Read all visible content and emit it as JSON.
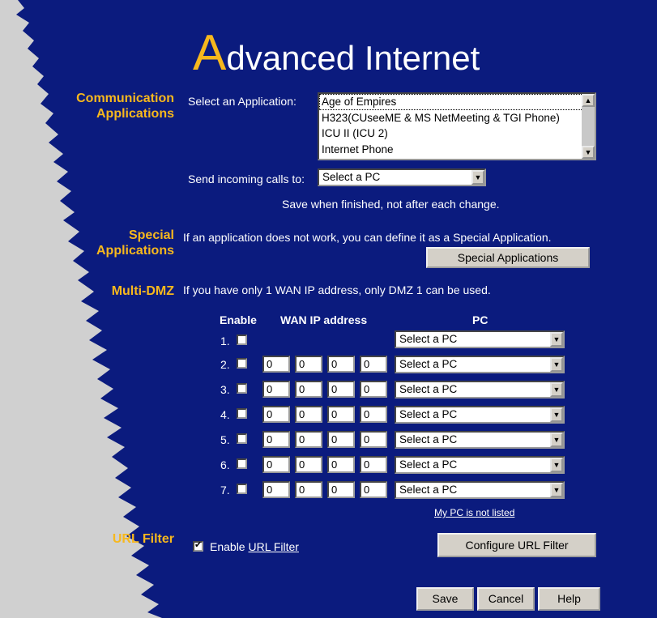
{
  "title": {
    "first_letter": "A",
    "rest": "dvanced Internet"
  },
  "colors": {
    "background": "#0b1b7e",
    "accent": "#f7b81d",
    "text": "#ffffff"
  },
  "communication": {
    "section_line1": "Communication",
    "section_line2": "Applications",
    "select_app_label": "Select an Application:",
    "applications": [
      "Age of Empires",
      "H323(CUseeME & MS NetMeeting & TGI Phone)",
      "ICU II (ICU 2)",
      "Internet Phone"
    ],
    "send_calls_label": "Send incoming calls to:",
    "send_calls_value": "Select a PC",
    "save_note": "Save when finished, not after each change."
  },
  "special": {
    "section_line1": "Special",
    "section_line2": "Applications",
    "description": "If an application does not work, you can define it as a Special Application.",
    "button": "Special Applications"
  },
  "dmz": {
    "section": "Multi-DMZ",
    "note": "If you have only 1 WAN IP address, only DMZ 1 can be used.",
    "col_enable": "Enable",
    "col_wan": "WAN IP address",
    "col_pc": "PC",
    "rows": [
      {
        "num": "1.",
        "ip": null,
        "pc": "Select a PC"
      },
      {
        "num": "2.",
        "ip": [
          "0",
          "0",
          "0",
          "0"
        ],
        "pc": "Select a PC"
      },
      {
        "num": "3.",
        "ip": [
          "0",
          "0",
          "0",
          "0"
        ],
        "pc": "Select a PC"
      },
      {
        "num": "4.",
        "ip": [
          "0",
          "0",
          "0",
          "0"
        ],
        "pc": "Select a PC"
      },
      {
        "num": "5.",
        "ip": [
          "0",
          "0",
          "0",
          "0"
        ],
        "pc": "Select a PC"
      },
      {
        "num": "6.",
        "ip": [
          "0",
          "0",
          "0",
          "0"
        ],
        "pc": "Select a PC"
      },
      {
        "num": "7.",
        "ip": [
          "0",
          "0",
          "0",
          "0"
        ],
        "pc": "Select a PC"
      }
    ],
    "not_listed_link": "My PC is not listed"
  },
  "url_filter": {
    "section": "URL Filter",
    "enable_prefix": "Enable ",
    "enable_link": "URL Filter",
    "enabled": true,
    "configure_button": "Configure URL Filter"
  },
  "footer": {
    "save": "Save",
    "cancel": "Cancel",
    "help": "Help"
  }
}
